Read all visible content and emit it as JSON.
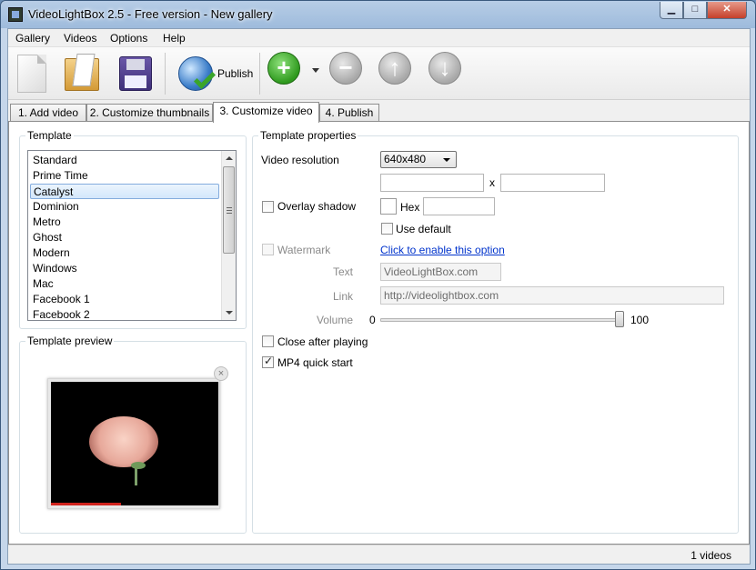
{
  "window": {
    "title": "VideoLightBox 2.5 - Free version - New gallery",
    "minimize": "▁",
    "maximize": "□",
    "close": "✕"
  },
  "menu": [
    "Gallery",
    "Videos",
    "Options",
    "Help"
  ],
  "toolbar": {
    "publish_label": "Publish",
    "icons": [
      "new-file-icon",
      "open-folder-icon",
      "save-icon",
      "publish-globe-icon",
      "add-icon",
      "remove-icon",
      "move-up-icon",
      "move-down-icon"
    ],
    "add": "+",
    "remove": "−",
    "up": "↑",
    "down": "↓"
  },
  "tabs": [
    "1. Add video",
    "2. Customize thumbnails",
    "3. Customize video",
    "4. Publish"
  ],
  "active_tab": 2,
  "template": {
    "group_title": "Template",
    "items": [
      "Standard",
      "Prime Time",
      "Catalyst",
      "Dominion",
      "Metro",
      "Ghost",
      "Modern",
      "Windows",
      "Mac",
      "Facebook 1",
      "Facebook 2"
    ],
    "selected_index": 2
  },
  "preview": {
    "group_title": "Template preview",
    "close": "×"
  },
  "properties": {
    "group_title": "Template properties",
    "video_resolution_label": "Video resolution",
    "video_resolution_value": "640x480",
    "width_value": "",
    "height_value": "",
    "x_separator": "x",
    "overlay_shadow_label": "Overlay shadow",
    "overlay_shadow_checked": false,
    "hex_label": "Hex",
    "hex_value": "",
    "use_default_label": "Use default",
    "use_default_checked": false,
    "watermark_label": "Watermark",
    "watermark_checked": false,
    "enable_option_link": "Click to enable this option",
    "text_label": "Text",
    "text_value": "VideoLightBox.com",
    "link_label": "Link",
    "link_value": "http://videolightbox.com",
    "volume_label": "Volume",
    "volume_min": "0",
    "volume_max": "100",
    "volume_value": 100,
    "close_after_playing_label": "Close after playing",
    "close_after_playing_checked": false,
    "mp4_quick_start_label": "MP4 quick start",
    "mp4_quick_start_checked": true
  },
  "status": {
    "count_text": "1 videos"
  }
}
